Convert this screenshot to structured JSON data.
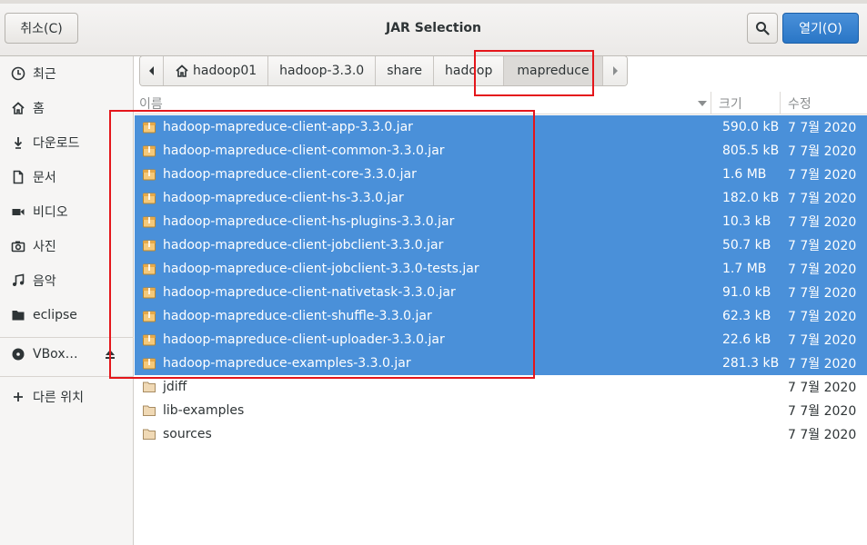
{
  "header": {
    "title": "JAR Selection",
    "cancel_label": "취소(C)",
    "open_label": "열기(O)",
    "search_icon": "search-icon"
  },
  "sidebar": {
    "items": [
      {
        "label": "최근",
        "icon": "clock-icon"
      },
      {
        "label": "홈",
        "icon": "home-icon"
      },
      {
        "label": "다운로드",
        "icon": "download-icon"
      },
      {
        "label": "문서",
        "icon": "document-icon"
      },
      {
        "label": "비디오",
        "icon": "video-icon"
      },
      {
        "label": "사진",
        "icon": "camera-icon"
      },
      {
        "label": "음악",
        "icon": "music-icon"
      },
      {
        "label": "eclipse",
        "icon": "folder-icon"
      }
    ],
    "device": {
      "label": "VBox…",
      "icon": "disc-icon",
      "eject_icon": "eject-icon"
    },
    "other": {
      "label": "다른 위치",
      "icon": "plus-icon"
    }
  },
  "pathbar": {
    "segments": [
      "hadoop01",
      "hadoop-3.3.0",
      "share",
      "hadoop",
      "mapreduce"
    ],
    "active": "mapreduce"
  },
  "columns": {
    "name": "이름",
    "size": "크기",
    "modified": "수정"
  },
  "files": [
    {
      "name": "hadoop-mapreduce-client-app-3.3.0.jar",
      "size": "590.0 kB",
      "date": "7 7월 2020",
      "selected": true,
      "type": "jar"
    },
    {
      "name": "hadoop-mapreduce-client-common-3.3.0.jar",
      "size": "805.5 kB",
      "date": "7 7월 2020",
      "selected": true,
      "type": "jar"
    },
    {
      "name": "hadoop-mapreduce-client-core-3.3.0.jar",
      "size": "1.6 MB",
      "date": "7 7월 2020",
      "selected": true,
      "type": "jar"
    },
    {
      "name": "hadoop-mapreduce-client-hs-3.3.0.jar",
      "size": "182.0 kB",
      "date": "7 7월 2020",
      "selected": true,
      "type": "jar"
    },
    {
      "name": "hadoop-mapreduce-client-hs-plugins-3.3.0.jar",
      "size": "10.3 kB",
      "date": "7 7월 2020",
      "selected": true,
      "type": "jar"
    },
    {
      "name": "hadoop-mapreduce-client-jobclient-3.3.0.jar",
      "size": "50.7 kB",
      "date": "7 7월 2020",
      "selected": true,
      "type": "jar"
    },
    {
      "name": "hadoop-mapreduce-client-jobclient-3.3.0-tests.jar",
      "size": "1.7 MB",
      "date": "7 7월 2020",
      "selected": true,
      "type": "jar"
    },
    {
      "name": "hadoop-mapreduce-client-nativetask-3.3.0.jar",
      "size": "91.0 kB",
      "date": "7 7월 2020",
      "selected": true,
      "type": "jar"
    },
    {
      "name": "hadoop-mapreduce-client-shuffle-3.3.0.jar",
      "size": "62.3 kB",
      "date": "7 7월 2020",
      "selected": true,
      "type": "jar"
    },
    {
      "name": "hadoop-mapreduce-client-uploader-3.3.0.jar",
      "size": "22.6 kB",
      "date": "7 7월 2020",
      "selected": true,
      "type": "jar"
    },
    {
      "name": "hadoop-mapreduce-examples-3.3.0.jar",
      "size": "281.3 kB",
      "date": "7 7월 2020",
      "selected": true,
      "type": "jar"
    },
    {
      "name": "jdiff",
      "size": "",
      "date": "7 7월 2020",
      "selected": false,
      "type": "folder"
    },
    {
      "name": "lib-examples",
      "size": "",
      "date": "7 7월 2020",
      "selected": false,
      "type": "folder"
    },
    {
      "name": "sources",
      "size": "",
      "date": "7 7월 2020",
      "selected": false,
      "type": "folder"
    }
  ],
  "colors": {
    "selection": "#4a90d9",
    "annotation": "#e4161b",
    "suggested_action": "#2a76c6"
  }
}
